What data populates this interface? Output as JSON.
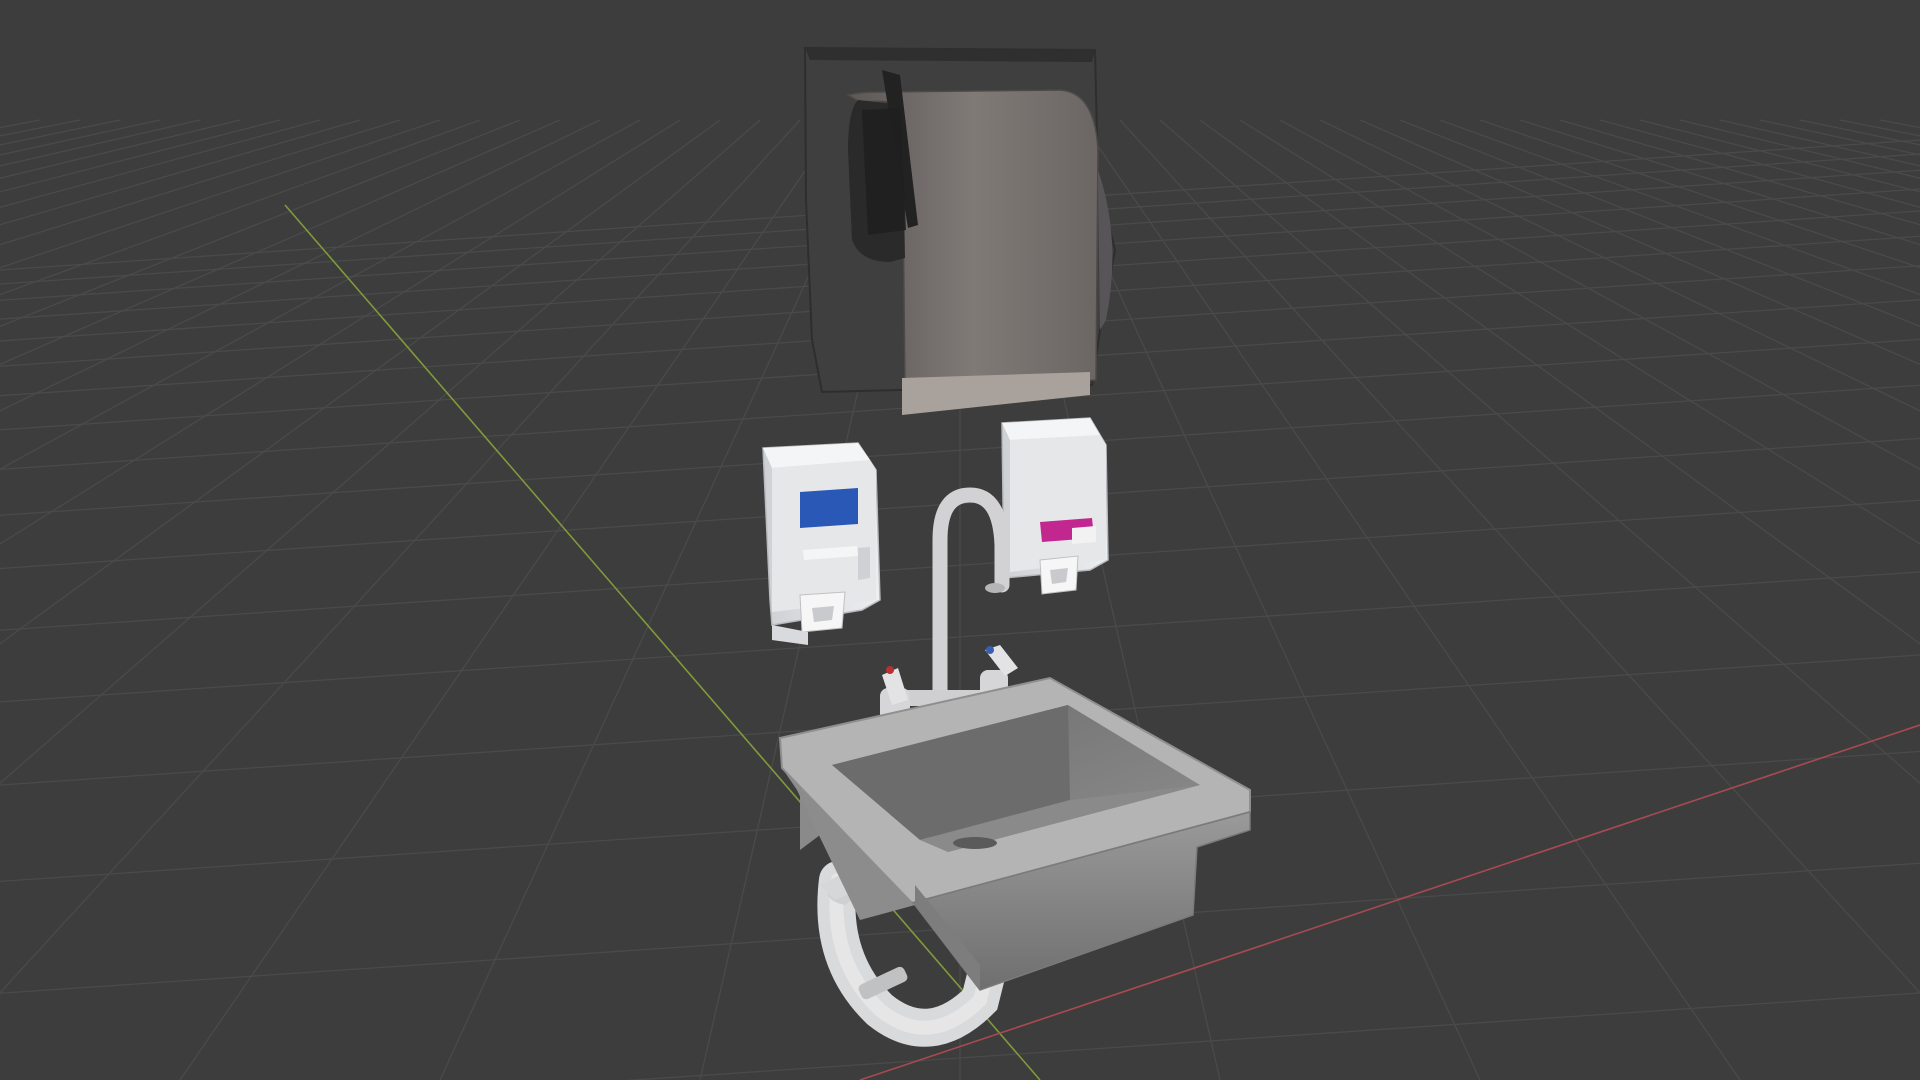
{
  "viewport": {
    "background_color": "#3d3d3d",
    "grid_color": "#4a4a4a",
    "x_axis_color": "#a84a52",
    "y_axis_color": "#7f9a3a"
  },
  "scene": {
    "objects": [
      {
        "name": "paper-towel-dispenser-icon"
      },
      {
        "name": "soap-dispenser-blue-icon"
      },
      {
        "name": "soap-dispenser-magenta-icon"
      },
      {
        "name": "gooseneck-faucet-icon"
      },
      {
        "name": "hand-wash-sink-icon"
      },
      {
        "name": "p-trap-drain-icon"
      }
    ]
  }
}
